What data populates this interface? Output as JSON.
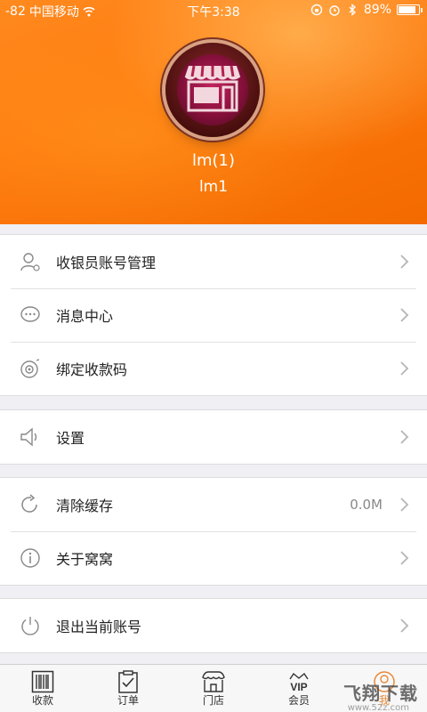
{
  "status_bar": {
    "signal": "-82",
    "carrier": "中国移动",
    "time": "下午3:38",
    "battery": "89%"
  },
  "profile": {
    "name": "lm(1)",
    "account": "lm1"
  },
  "menu": {
    "group1": [
      {
        "label": "收银员账号管理",
        "icon": "user-settings-icon"
      },
      {
        "label": "消息中心",
        "icon": "message-bubble-icon"
      },
      {
        "label": "绑定收款码",
        "icon": "qr-bind-icon"
      }
    ],
    "group2": [
      {
        "label": "设置",
        "icon": "speaker-icon"
      }
    ],
    "group3": [
      {
        "label": "清除缓存",
        "icon": "refresh-icon",
        "value": "0.0M"
      },
      {
        "label": "关于窝窝",
        "icon": "info-icon"
      }
    ],
    "group4": [
      {
        "label": "退出当前账号",
        "icon": "power-icon"
      }
    ]
  },
  "tabbar": [
    {
      "label": "收款",
      "icon": "barcode-icon"
    },
    {
      "label": "订单",
      "icon": "clipboard-check-icon"
    },
    {
      "label": "门店",
      "icon": "store-icon"
    },
    {
      "label": "会员",
      "icon": "vip-crown-icon"
    },
    {
      "label": "我",
      "icon": "profile-icon"
    }
  ],
  "watermark": {
    "text": "飞翔下载",
    "sub": "www.52z.com"
  },
  "colors": {
    "header": "#ff7a0f",
    "background": "#efeff4",
    "text": "#222222"
  }
}
